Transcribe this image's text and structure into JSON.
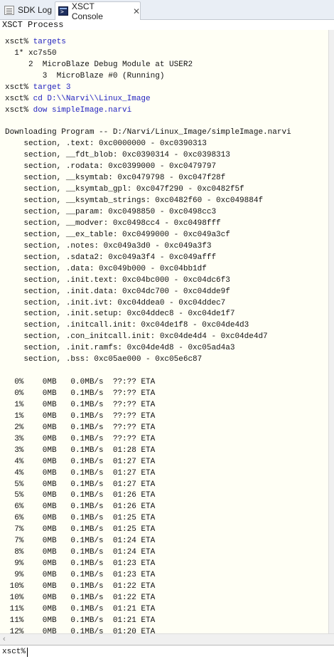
{
  "tabs": [
    {
      "label": "SDK Log",
      "icon": "log-icon"
    },
    {
      "label": "XSCT Console",
      "icon": "console-icon",
      "close": "✕"
    }
  ],
  "process_label": "XSCT Process",
  "console_lines": [
    {
      "prompt": "",
      "text": "                                   "
    },
    {
      "prompt": "xsct% ",
      "text": "targets"
    },
    {
      "prompt": "",
      "text": "  1* xc7s50"
    },
    {
      "prompt": "",
      "text": "     2  MicroBlaze Debug Module at USER2"
    },
    {
      "prompt": "",
      "text": "        3  MicroBlaze #0 (Running)"
    },
    {
      "prompt": "xsct% ",
      "text": "target 3"
    },
    {
      "prompt": "xsct% ",
      "text": "cd D:\\\\Narvi\\\\Linux_Image"
    },
    {
      "prompt": "xsct% ",
      "text": "dow simpleImage.narvi"
    },
    {
      "prompt": "",
      "text": ""
    },
    {
      "prompt": "",
      "text": "Downloading Program -- D:/Narvi/Linux_Image/simpleImage.narvi"
    },
    {
      "prompt": "",
      "text": "    section, .text: 0xc0000000 - 0xc0390313"
    },
    {
      "prompt": "",
      "text": "    section, __fdt_blob: 0xc0390314 - 0xc0398313"
    },
    {
      "prompt": "",
      "text": "    section, .rodata: 0xc0399000 - 0xc0479797"
    },
    {
      "prompt": "",
      "text": "    section, __ksymtab: 0xc0479798 - 0xc047f28f"
    },
    {
      "prompt": "",
      "text": "    section, __ksymtab_gpl: 0xc047f290 - 0xc0482f5f"
    },
    {
      "prompt": "",
      "text": "    section, __ksymtab_strings: 0xc0482f60 - 0xc049884f"
    },
    {
      "prompt": "",
      "text": "    section, __param: 0xc0498850 - 0xc0498cc3"
    },
    {
      "prompt": "",
      "text": "    section, __modver: 0xc0498cc4 - 0xc0498fff"
    },
    {
      "prompt": "",
      "text": "    section, __ex_table: 0xc0499000 - 0xc049a3cf"
    },
    {
      "prompt": "",
      "text": "    section, .notes: 0xc049a3d0 - 0xc049a3f3"
    },
    {
      "prompt": "",
      "text": "    section, .sdata2: 0xc049a3f4 - 0xc049afff"
    },
    {
      "prompt": "",
      "text": "    section, .data: 0xc049b000 - 0xc04bb1df"
    },
    {
      "prompt": "",
      "text": "    section, .init.text: 0xc04bc000 - 0xc04dc6f3"
    },
    {
      "prompt": "",
      "text": "    section, .init.data: 0xc04dc700 - 0xc04dde9f"
    },
    {
      "prompt": "",
      "text": "    section, .init.ivt: 0xc04ddea0 - 0xc04ddec7"
    },
    {
      "prompt": "",
      "text": "    section, .init.setup: 0xc04ddec8 - 0xc04de1f7"
    },
    {
      "prompt": "",
      "text": "    section, .initcall.init: 0xc04de1f8 - 0xc04de4d3"
    },
    {
      "prompt": "",
      "text": "    section, .con_initcall.init: 0xc04de4d4 - 0xc04de4d7"
    },
    {
      "prompt": "",
      "text": "    section, .init.ramfs: 0xc04de4d8 - 0xc05ad4a3"
    },
    {
      "prompt": "",
      "text": "    section, .bss: 0xc05ae000 - 0xc05e6c87"
    },
    {
      "prompt": "",
      "text": ""
    },
    {
      "prompt": "",
      "text": "  0%    0MB   0.0MB/s  ??:?? ETA"
    },
    {
      "prompt": "",
      "text": "  0%    0MB   0.1MB/s  ??:?? ETA"
    },
    {
      "prompt": "",
      "text": "  1%    0MB   0.1MB/s  ??:?? ETA"
    },
    {
      "prompt": "",
      "text": "  1%    0MB   0.1MB/s  ??:?? ETA"
    },
    {
      "prompt": "",
      "text": "  2%    0MB   0.1MB/s  ??:?? ETA"
    },
    {
      "prompt": "",
      "text": "  3%    0MB   0.1MB/s  ??:?? ETA"
    },
    {
      "prompt": "",
      "text": "  3%    0MB   0.1MB/s  01:28 ETA"
    },
    {
      "prompt": "",
      "text": "  4%    0MB   0.1MB/s  01:27 ETA"
    },
    {
      "prompt": "",
      "text": "  4%    0MB   0.1MB/s  01:27 ETA"
    },
    {
      "prompt": "",
      "text": "  5%    0MB   0.1MB/s  01:27 ETA"
    },
    {
      "prompt": "",
      "text": "  5%    0MB   0.1MB/s  01:26 ETA"
    },
    {
      "prompt": "",
      "text": "  6%    0MB   0.1MB/s  01:26 ETA"
    },
    {
      "prompt": "",
      "text": "  6%    0MB   0.1MB/s  01:25 ETA"
    },
    {
      "prompt": "",
      "text": "  7%    0MB   0.1MB/s  01:25 ETA"
    },
    {
      "prompt": "",
      "text": "  7%    0MB   0.1MB/s  01:24 ETA"
    },
    {
      "prompt": "",
      "text": "  8%    0MB   0.1MB/s  01:24 ETA"
    },
    {
      "prompt": "",
      "text": "  9%    0MB   0.1MB/s  01:23 ETA"
    },
    {
      "prompt": "",
      "text": "  9%    0MB   0.1MB/s  01:23 ETA"
    },
    {
      "prompt": "",
      "text": " 10%    0MB   0.1MB/s  01:22 ETA"
    },
    {
      "prompt": "",
      "text": " 10%    0MB   0.1MB/s  01:22 ETA"
    },
    {
      "prompt": "",
      "text": " 11%    0MB   0.1MB/s  01:21 ETA"
    },
    {
      "prompt": "",
      "text": " 11%    0MB   0.1MB/s  01:21 ETA"
    },
    {
      "prompt": "",
      "text": " 12%    0MB   0.1MB/s  01:20 ETA"
    }
  ],
  "input": {
    "prompt": "xsct%",
    "value": ""
  },
  "colors": {
    "command_text": "#1f1fbe",
    "console_bg": "#fffff5",
    "tab_bar_bg": "#e9eef5"
  }
}
